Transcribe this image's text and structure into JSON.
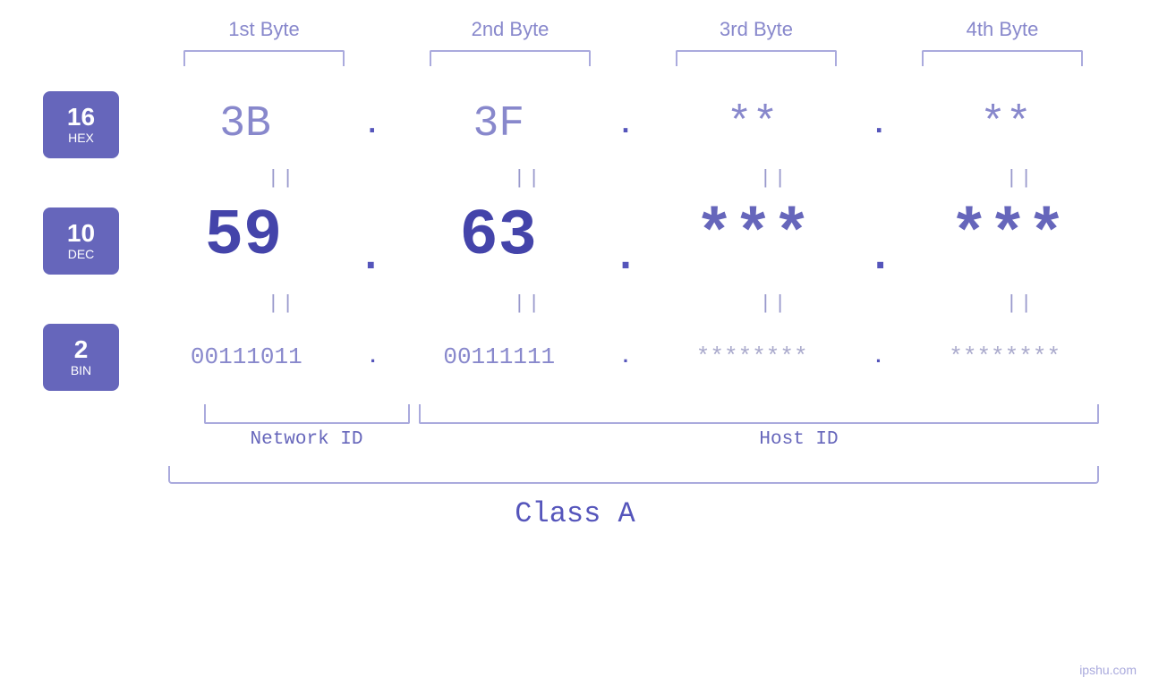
{
  "headers": {
    "byte1": "1st Byte",
    "byte2": "2nd Byte",
    "byte3": "3rd Byte",
    "byte4": "4th Byte"
  },
  "badges": {
    "hex": {
      "number": "16",
      "label": "HEX"
    },
    "dec": {
      "number": "10",
      "label": "DEC"
    },
    "bin": {
      "number": "2",
      "label": "BIN"
    }
  },
  "hex_values": {
    "b1": "3B",
    "b2": "3F",
    "b3": "**",
    "b4": "**"
  },
  "dec_values": {
    "b1": "59",
    "b2": "63",
    "b3": "***",
    "b4": "***"
  },
  "bin_values": {
    "b1": "00111011",
    "b2": "00111111",
    "b3": "********",
    "b4": "********"
  },
  "labels": {
    "network_id": "Network ID",
    "host_id": "Host ID",
    "class": "Class A"
  },
  "equals": "||",
  "dot": ".",
  "watermark": "ipshu.com"
}
